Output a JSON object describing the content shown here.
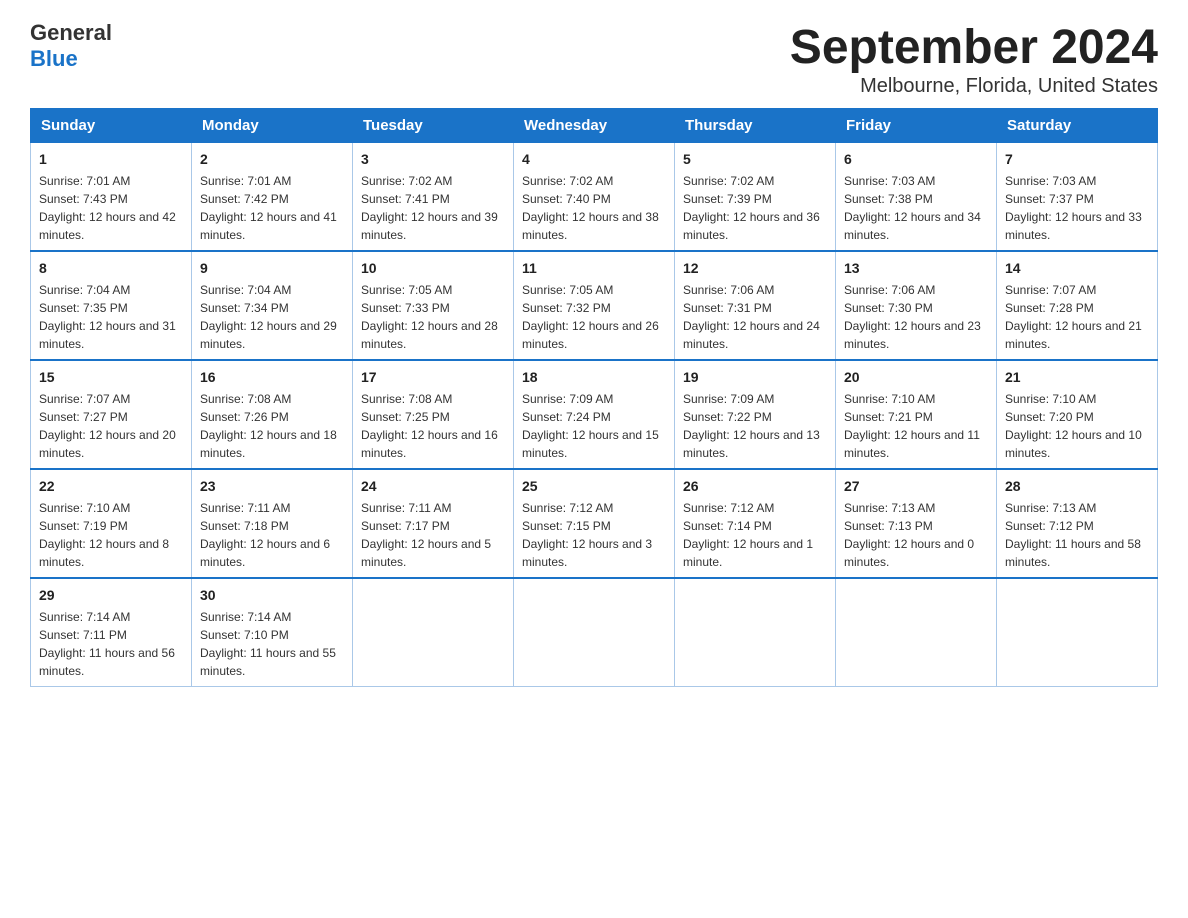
{
  "header": {
    "logo_general": "General",
    "logo_blue": "Blue",
    "month_title": "September 2024",
    "subtitle": "Melbourne, Florida, United States"
  },
  "days_of_week": [
    "Sunday",
    "Monday",
    "Tuesday",
    "Wednesday",
    "Thursday",
    "Friday",
    "Saturday"
  ],
  "weeks": [
    [
      {
        "day": "1",
        "sunrise": "7:01 AM",
        "sunset": "7:43 PM",
        "daylight": "12 hours and 42 minutes."
      },
      {
        "day": "2",
        "sunrise": "7:01 AM",
        "sunset": "7:42 PM",
        "daylight": "12 hours and 41 minutes."
      },
      {
        "day": "3",
        "sunrise": "7:02 AM",
        "sunset": "7:41 PM",
        "daylight": "12 hours and 39 minutes."
      },
      {
        "day": "4",
        "sunrise": "7:02 AM",
        "sunset": "7:40 PM",
        "daylight": "12 hours and 38 minutes."
      },
      {
        "day": "5",
        "sunrise": "7:02 AM",
        "sunset": "7:39 PM",
        "daylight": "12 hours and 36 minutes."
      },
      {
        "day": "6",
        "sunrise": "7:03 AM",
        "sunset": "7:38 PM",
        "daylight": "12 hours and 34 minutes."
      },
      {
        "day": "7",
        "sunrise": "7:03 AM",
        "sunset": "7:37 PM",
        "daylight": "12 hours and 33 minutes."
      }
    ],
    [
      {
        "day": "8",
        "sunrise": "7:04 AM",
        "sunset": "7:35 PM",
        "daylight": "12 hours and 31 minutes."
      },
      {
        "day": "9",
        "sunrise": "7:04 AM",
        "sunset": "7:34 PM",
        "daylight": "12 hours and 29 minutes."
      },
      {
        "day": "10",
        "sunrise": "7:05 AM",
        "sunset": "7:33 PM",
        "daylight": "12 hours and 28 minutes."
      },
      {
        "day": "11",
        "sunrise": "7:05 AM",
        "sunset": "7:32 PM",
        "daylight": "12 hours and 26 minutes."
      },
      {
        "day": "12",
        "sunrise": "7:06 AM",
        "sunset": "7:31 PM",
        "daylight": "12 hours and 24 minutes."
      },
      {
        "day": "13",
        "sunrise": "7:06 AM",
        "sunset": "7:30 PM",
        "daylight": "12 hours and 23 minutes."
      },
      {
        "day": "14",
        "sunrise": "7:07 AM",
        "sunset": "7:28 PM",
        "daylight": "12 hours and 21 minutes."
      }
    ],
    [
      {
        "day": "15",
        "sunrise": "7:07 AM",
        "sunset": "7:27 PM",
        "daylight": "12 hours and 20 minutes."
      },
      {
        "day": "16",
        "sunrise": "7:08 AM",
        "sunset": "7:26 PM",
        "daylight": "12 hours and 18 minutes."
      },
      {
        "day": "17",
        "sunrise": "7:08 AM",
        "sunset": "7:25 PM",
        "daylight": "12 hours and 16 minutes."
      },
      {
        "day": "18",
        "sunrise": "7:09 AM",
        "sunset": "7:24 PM",
        "daylight": "12 hours and 15 minutes."
      },
      {
        "day": "19",
        "sunrise": "7:09 AM",
        "sunset": "7:22 PM",
        "daylight": "12 hours and 13 minutes."
      },
      {
        "day": "20",
        "sunrise": "7:10 AM",
        "sunset": "7:21 PM",
        "daylight": "12 hours and 11 minutes."
      },
      {
        "day": "21",
        "sunrise": "7:10 AM",
        "sunset": "7:20 PM",
        "daylight": "12 hours and 10 minutes."
      }
    ],
    [
      {
        "day": "22",
        "sunrise": "7:10 AM",
        "sunset": "7:19 PM",
        "daylight": "12 hours and 8 minutes."
      },
      {
        "day": "23",
        "sunrise": "7:11 AM",
        "sunset": "7:18 PM",
        "daylight": "12 hours and 6 minutes."
      },
      {
        "day": "24",
        "sunrise": "7:11 AM",
        "sunset": "7:17 PM",
        "daylight": "12 hours and 5 minutes."
      },
      {
        "day": "25",
        "sunrise": "7:12 AM",
        "sunset": "7:15 PM",
        "daylight": "12 hours and 3 minutes."
      },
      {
        "day": "26",
        "sunrise": "7:12 AM",
        "sunset": "7:14 PM",
        "daylight": "12 hours and 1 minute."
      },
      {
        "day": "27",
        "sunrise": "7:13 AM",
        "sunset": "7:13 PM",
        "daylight": "12 hours and 0 minutes."
      },
      {
        "day": "28",
        "sunrise": "7:13 AM",
        "sunset": "7:12 PM",
        "daylight": "11 hours and 58 minutes."
      }
    ],
    [
      {
        "day": "29",
        "sunrise": "7:14 AM",
        "sunset": "7:11 PM",
        "daylight": "11 hours and 56 minutes."
      },
      {
        "day": "30",
        "sunrise": "7:14 AM",
        "sunset": "7:10 PM",
        "daylight": "11 hours and 55 minutes."
      },
      null,
      null,
      null,
      null,
      null
    ]
  ],
  "labels": {
    "sunrise": "Sunrise:",
    "sunset": "Sunset:",
    "daylight": "Daylight:"
  }
}
